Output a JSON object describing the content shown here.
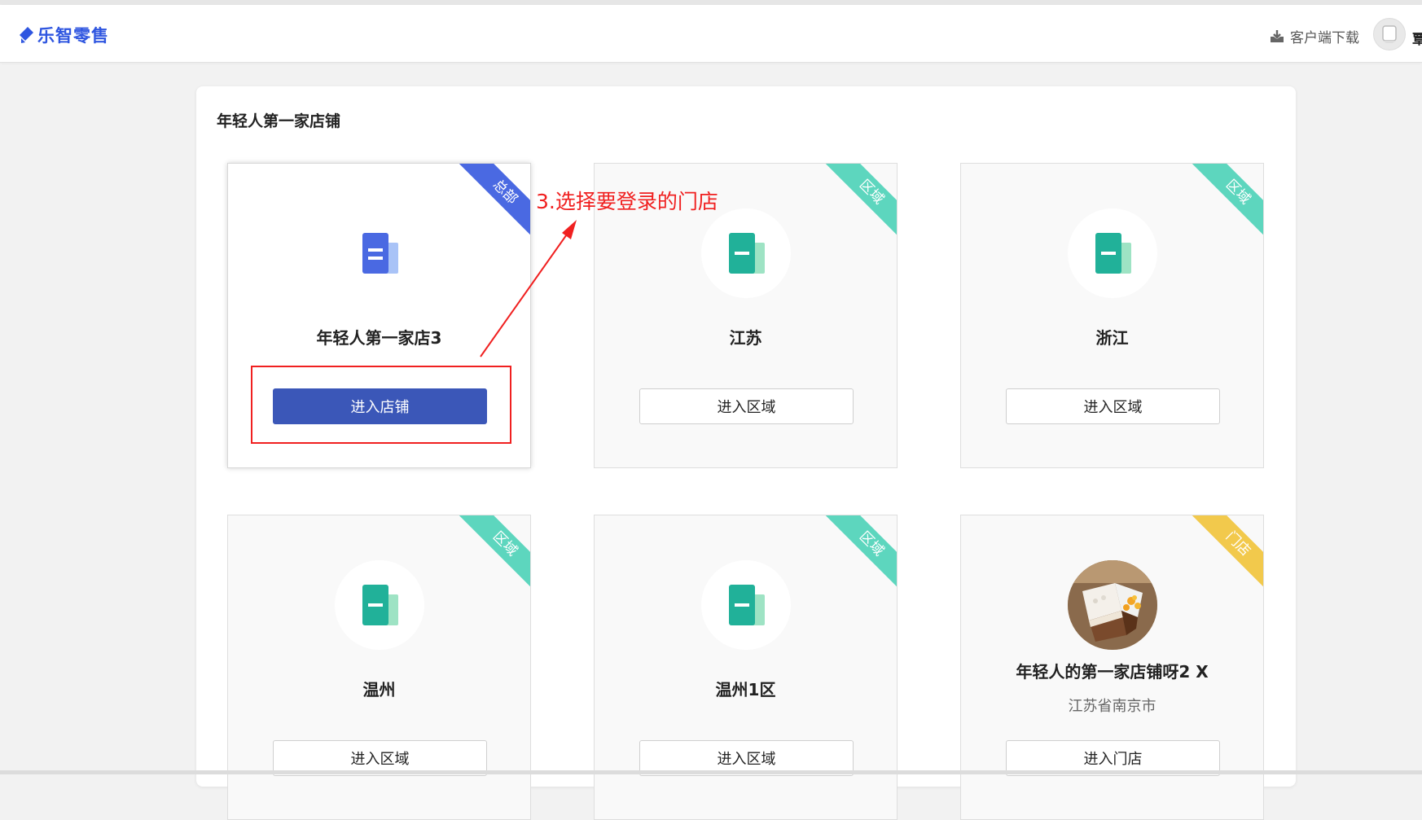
{
  "header": {
    "logo_text": "乐智零售",
    "download_label": "客户端下载",
    "user_name": "覃"
  },
  "company": {
    "title": "年轻人第一家店铺"
  },
  "cards": [
    {
      "name": "年轻人第一家店3",
      "tag": "总部",
      "button": "进入店铺",
      "icon": "store-doc-icon",
      "tag_color": "#4a69e2"
    },
    {
      "name": "江苏",
      "tag": "区域",
      "button": "进入区域",
      "icon": "region-doc-icon",
      "tag_color": "#5dd6be"
    },
    {
      "name": "浙江",
      "tag": "区域",
      "button": "进入区域",
      "icon": "region-doc-icon",
      "tag_color": "#5dd6be"
    },
    {
      "name": "温州",
      "tag": "区域",
      "button": "进入区域",
      "icon": "region-doc-icon",
      "tag_color": "#5dd6be"
    },
    {
      "name": "温州1区",
      "tag": "区域",
      "button": "进入区域",
      "icon": "region-doc-icon",
      "tag_color": "#5dd6be"
    },
    {
      "name": "年轻人的第一家店铺呀2 X",
      "tag": "门店",
      "button": "进入门店",
      "subtitle": "江苏省南京市",
      "icon": "cake-photo",
      "tag_color": "#f2c94c"
    }
  ],
  "annotation": {
    "text": "3.选择要登录的门店",
    "color": "#f02020"
  },
  "colors": {
    "brand": "#2f56e0",
    "primary_button": "#3b57b8",
    "tag_region": "#5dd6be",
    "tag_hq": "#4a69e2",
    "tag_store": "#f2c94c"
  }
}
